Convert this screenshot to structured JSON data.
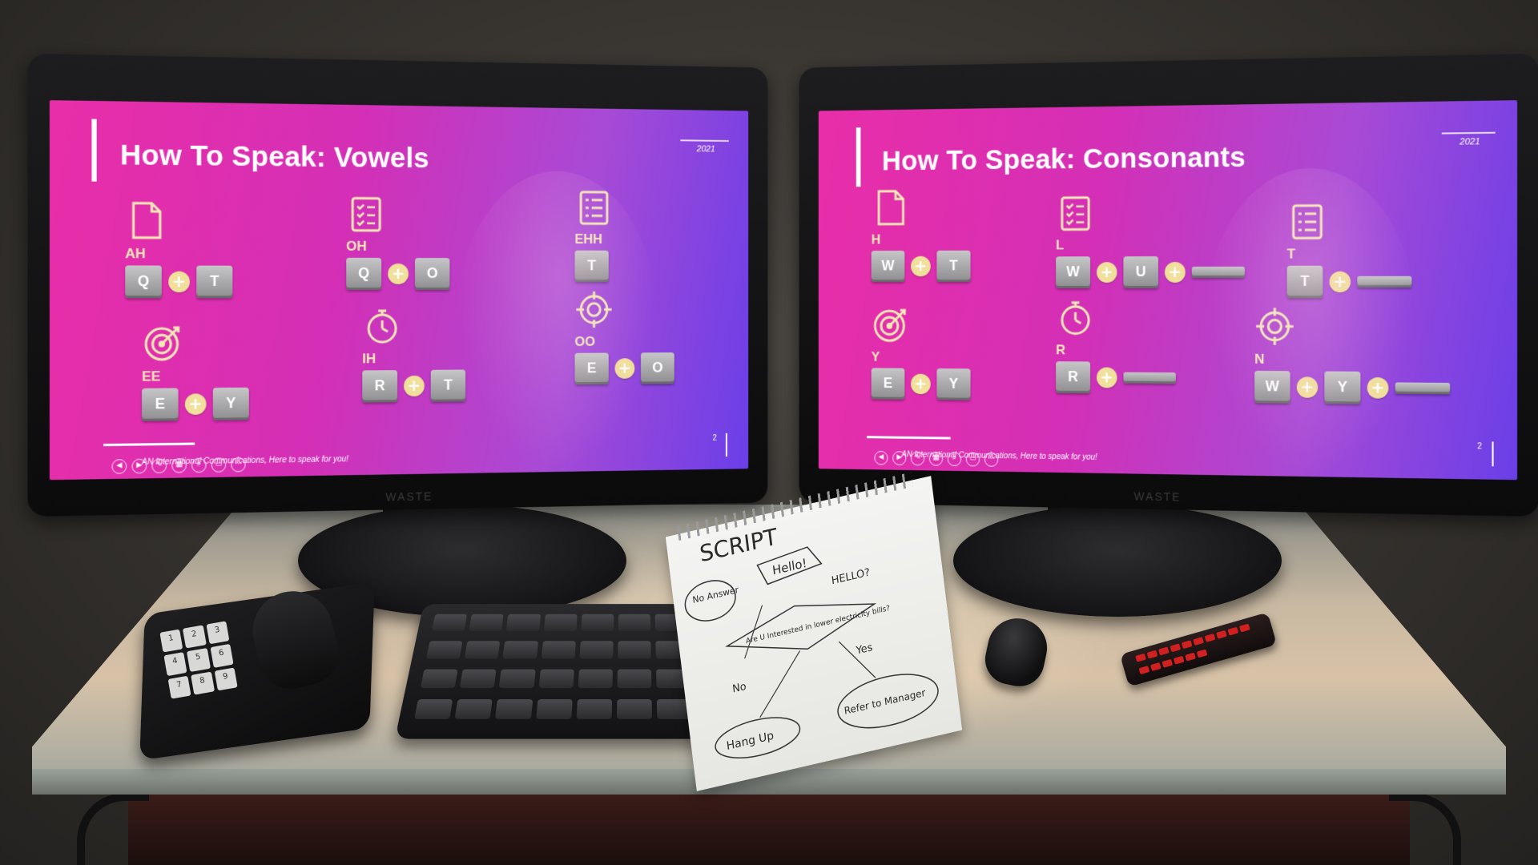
{
  "left_slide": {
    "title": "How To Speak: Vowels",
    "year": "2021",
    "footer": "AN International Communications, Here to speak for you!",
    "page": "2",
    "sounds": [
      {
        "label": "AH",
        "icon": "document-icon",
        "keys": [
          "Q",
          "T"
        ]
      },
      {
        "label": "OH",
        "icon": "checklist-icon",
        "keys": [
          "Q",
          "O"
        ]
      },
      {
        "label": "EHH",
        "icon": "list-icon",
        "keys": [
          "T"
        ]
      },
      {
        "label": "EE",
        "icon": "target-icon",
        "keys": [
          "E",
          "Y"
        ]
      },
      {
        "label": "IH",
        "icon": "stopwatch-icon",
        "keys": [
          "R",
          "T"
        ]
      },
      {
        "label": "OO",
        "icon": "crosshair-icon",
        "keys": [
          "E",
          "O"
        ]
      }
    ]
  },
  "right_slide": {
    "title": "How To Speak: Consonants",
    "year": "2021",
    "footer": "AN International Communications, Here to speak for you!",
    "page": "2",
    "sounds": [
      {
        "label": "H",
        "icon": "document-icon",
        "keys": [
          "W",
          "T"
        ]
      },
      {
        "label": "L",
        "icon": "checklist-icon",
        "keys": [
          "W",
          "U",
          ""
        ]
      },
      {
        "label": "T",
        "icon": "list-icon",
        "keys": [
          "T",
          ""
        ]
      },
      {
        "label": "Y",
        "icon": "target-icon",
        "keys": [
          "E",
          "Y"
        ]
      },
      {
        "label": "R",
        "icon": "stopwatch-icon",
        "keys": [
          "R",
          ""
        ]
      },
      {
        "label": "N",
        "icon": "crosshair-icon",
        "keys": [
          "W",
          "Y",
          ""
        ]
      }
    ]
  },
  "monitor_brand": "WASTE",
  "notepad": {
    "heading": "SCRIPT",
    "hello": "Hello!",
    "hello_q": "HELLO?",
    "no_answer": "No Answer",
    "question": "Are U Interested in lower electricity bills?",
    "no": "No",
    "yes": "Yes",
    "hang_up": "Hang Up",
    "refer": "Refer to Manager"
  },
  "phone_keys": [
    "1",
    "2",
    "3",
    "4",
    "5",
    "6",
    "7",
    "8",
    "9"
  ],
  "colors": {
    "slide_pink": "#e92ea8",
    "slide_purple": "#6a3fe8",
    "accent_yellow": "#f4e9b6",
    "key_gray": "#a6a6a9"
  }
}
